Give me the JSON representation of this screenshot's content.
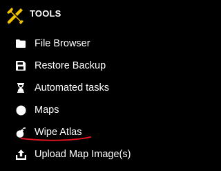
{
  "header": {
    "title": "TOOLS",
    "icon": "tools-icon",
    "icon_color": "#f2c200"
  },
  "menu": [
    {
      "label": "File Browser",
      "icon": "folder-icon"
    },
    {
      "label": "Restore Backup",
      "icon": "save-icon"
    },
    {
      "label": "Automated tasks",
      "icon": "hourglass-icon"
    },
    {
      "label": "Maps",
      "icon": "circle-icon"
    },
    {
      "label": "Wipe Atlas",
      "icon": "bomb-icon"
    },
    {
      "label": "Upload Map Image(s)",
      "icon": "upload-icon"
    }
  ],
  "annotation": {
    "underline_color": "#e0141e",
    "underlined_item": "Wipe Atlas"
  }
}
